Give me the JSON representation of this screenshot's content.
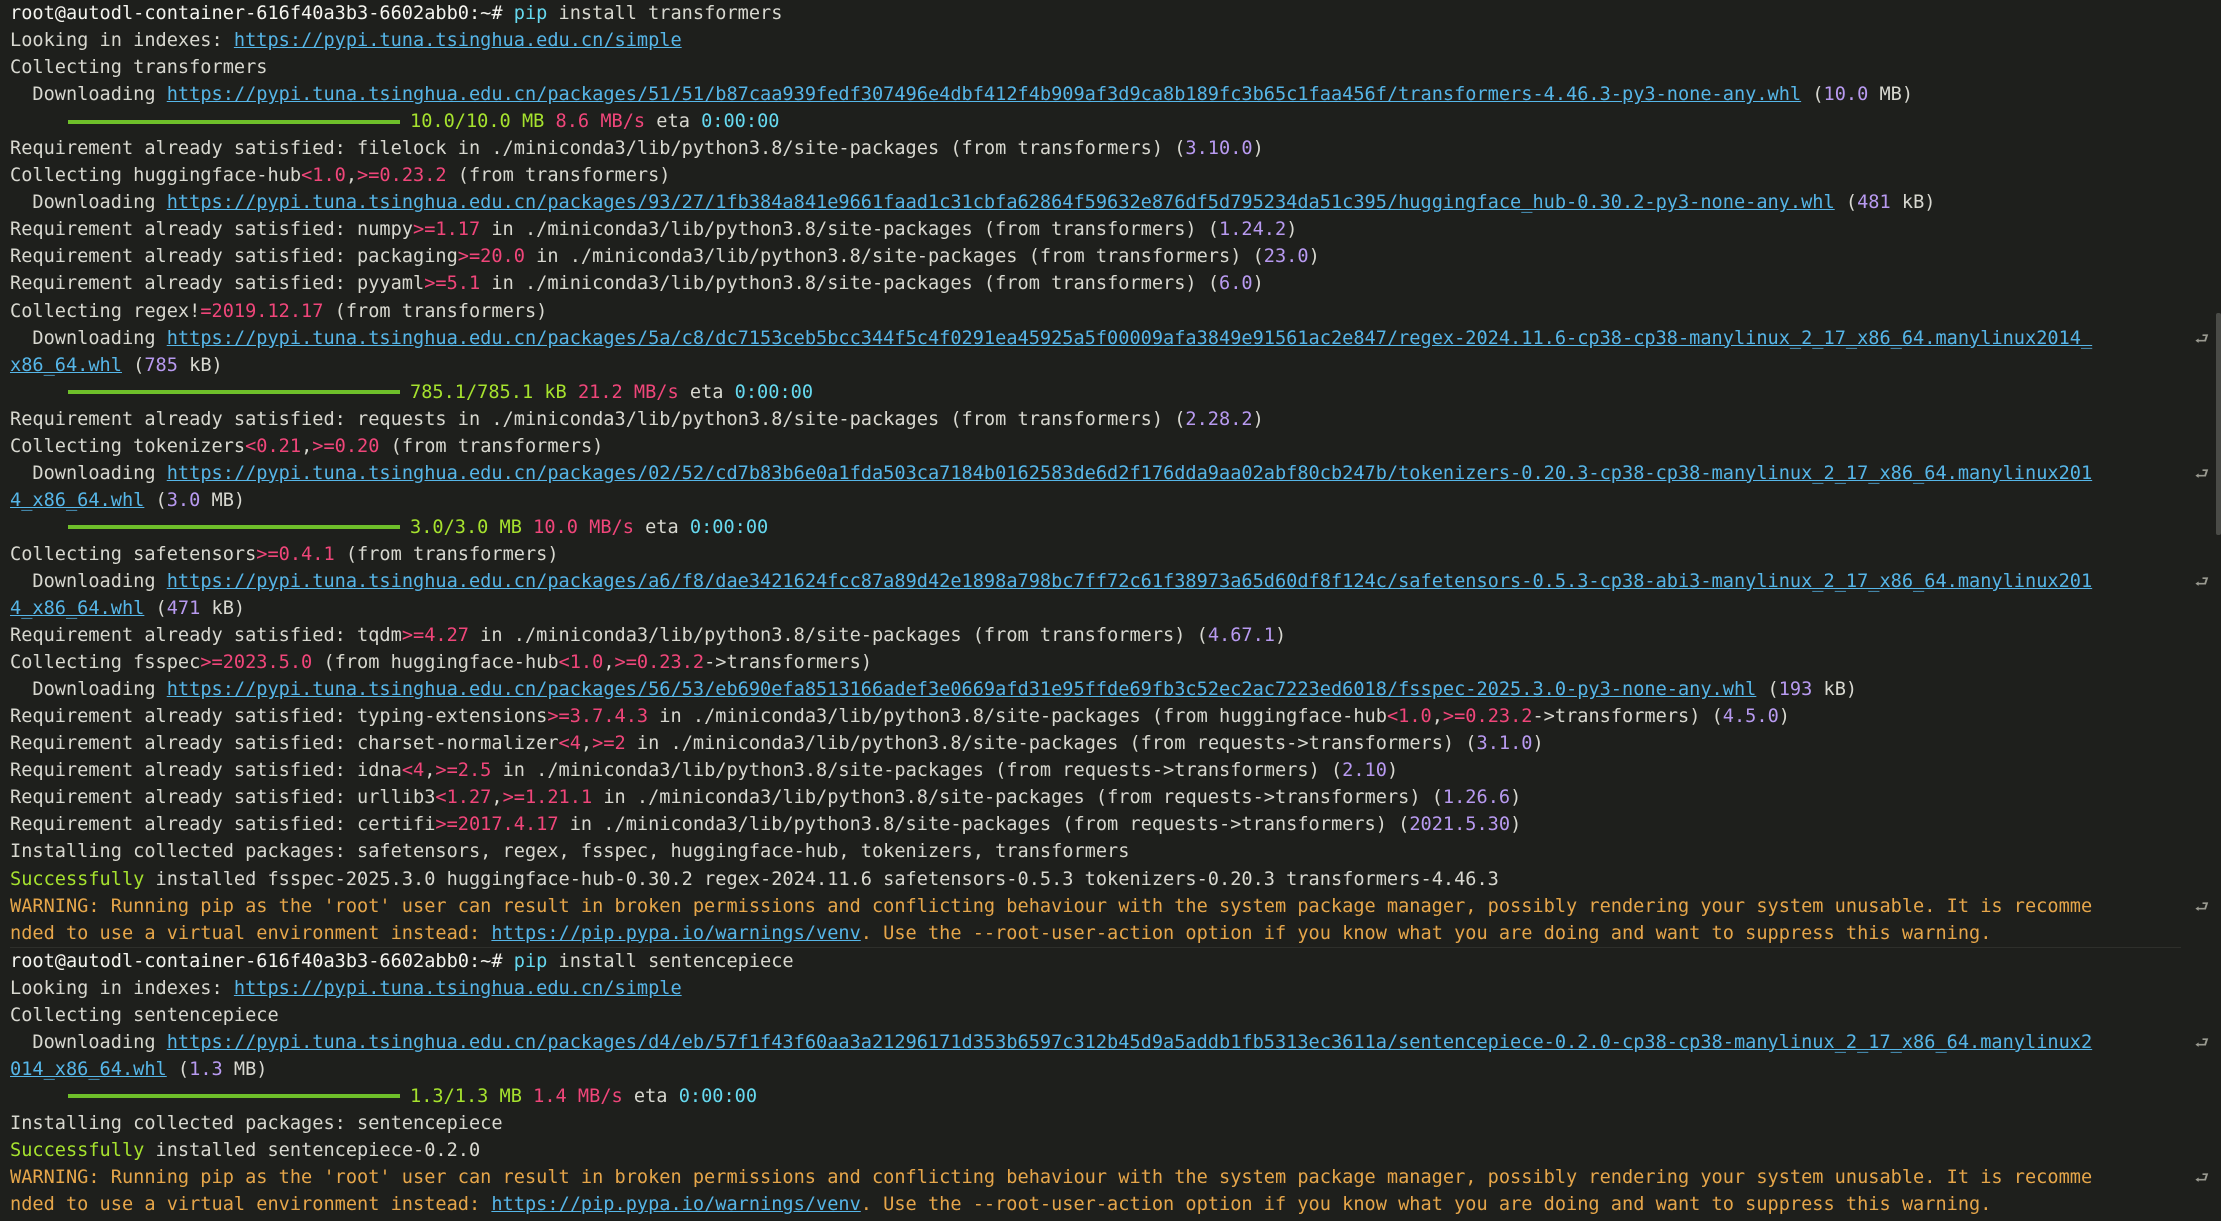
{
  "prompt": "root@autodl-container-616f40a3b3-6602abb0:~#",
  "lines": [
    {
      "segs": [
        [
          "t-bright",
          "root@autodl-container-616f40a3b3-6602abb0:~# "
        ],
        [
          "t-cyan",
          "pip"
        ],
        [
          "t-cmd",
          " install transformers"
        ]
      ]
    },
    {
      "segs": [
        [
          "t-plain",
          "Looking in indexes: "
        ],
        [
          "t-url",
          "https://pypi.tuna.tsinghua.edu.cn/simple"
        ]
      ]
    },
    {
      "segs": [
        [
          "t-plain",
          "Collecting transformers"
        ]
      ]
    },
    {
      "segs": [
        [
          "t-plain",
          "  Downloading "
        ],
        [
          "t-url",
          "https://pypi.tuna.tsinghua.edu.cn/packages/51/51/b87caa939fedf307496e4dbf412f4b909af3d9ca8b189fc3b65c1faa456f/transformers-4.46.3-py3-none-any.whl"
        ],
        [
          "t-plain",
          " ("
        ],
        [
          "t-num",
          "10.0"
        ],
        [
          "t-plain",
          " MB)"
        ]
      ]
    },
    {
      "progress": 1.0,
      "segs": [
        [
          "t-green",
          "10.0/10.0 MB"
        ],
        [
          "t-plain",
          " "
        ],
        [
          "t-pink",
          "8.6 MB/s"
        ],
        [
          "t-plain",
          " eta "
        ],
        [
          "t-cyan",
          "0:00:00"
        ]
      ]
    },
    {
      "segs": [
        [
          "t-plain",
          "Requirement already satisfied: filelock in ./miniconda3/lib/python3.8/site-packages (from transformers) ("
        ],
        [
          "t-num",
          "3.10.0"
        ],
        [
          "t-plain",
          ")"
        ]
      ]
    },
    {
      "segs": [
        [
          "t-plain",
          "Collecting huggingface-hub"
        ],
        [
          "t-pink",
          "<1.0"
        ],
        [
          "t-plain",
          ","
        ],
        [
          "t-pink",
          ">=0.23.2"
        ],
        [
          "t-plain",
          " (from transformers)"
        ]
      ]
    },
    {
      "segs": [
        [
          "t-plain",
          "  Downloading "
        ],
        [
          "t-url",
          "https://pypi.tuna.tsinghua.edu.cn/packages/93/27/1fb384a841e9661faad1c31cbfa62864f59632e876df5d795234da51c395/huggingface_hub-0.30.2-py3-none-any.whl"
        ],
        [
          "t-plain",
          " ("
        ],
        [
          "t-num",
          "481"
        ],
        [
          "t-plain",
          " kB)"
        ]
      ]
    },
    {
      "segs": [
        [
          "t-plain",
          "Requirement already satisfied: numpy"
        ],
        [
          "t-pink",
          ">=1.17"
        ],
        [
          "t-plain",
          " in ./miniconda3/lib/python3.8/site-packages (from transformers) ("
        ],
        [
          "t-num",
          "1.24.2"
        ],
        [
          "t-plain",
          ")"
        ]
      ]
    },
    {
      "segs": [
        [
          "t-plain",
          "Requirement already satisfied: packaging"
        ],
        [
          "t-pink",
          ">=20.0"
        ],
        [
          "t-plain",
          " in ./miniconda3/lib/python3.8/site-packages (from transformers) ("
        ],
        [
          "t-num",
          "23.0"
        ],
        [
          "t-plain",
          ")"
        ]
      ]
    },
    {
      "segs": [
        [
          "t-plain",
          "Requirement already satisfied: pyyaml"
        ],
        [
          "t-pink",
          ">=5.1"
        ],
        [
          "t-plain",
          " in ./miniconda3/lib/python3.8/site-packages (from transformers) ("
        ],
        [
          "t-num",
          "6.0"
        ],
        [
          "t-plain",
          ")"
        ]
      ]
    },
    {
      "segs": [
        [
          "t-plain",
          "Collecting regex!"
        ],
        [
          "t-pink",
          "=2019.12.17"
        ],
        [
          "t-plain",
          " (from transformers)"
        ]
      ]
    },
    {
      "wrap": true,
      "segs": [
        [
          "t-plain",
          "  Downloading "
        ],
        [
          "t-url",
          "https://pypi.tuna.tsinghua.edu.cn/packages/5a/c8/dc7153ceb5bcc344f5c4f0291ea45925a5f00009afa3849e91561ac2e847/regex-2024.11.6-cp38-cp38-manylinux_2_17_x86_64.manylinux2014_"
        ]
      ]
    },
    {
      "segs": [
        [
          "t-url",
          "x86_64.whl"
        ],
        [
          "t-plain",
          " ("
        ],
        [
          "t-num",
          "785"
        ],
        [
          "t-plain",
          " kB)"
        ]
      ]
    },
    {
      "progress": 1.0,
      "segs": [
        [
          "t-green",
          "785.1/785.1 kB"
        ],
        [
          "t-plain",
          " "
        ],
        [
          "t-pink",
          "21.2 MB/s"
        ],
        [
          "t-plain",
          " eta "
        ],
        [
          "t-cyan",
          "0:00:00"
        ]
      ]
    },
    {
      "segs": [
        [
          "t-plain",
          "Requirement already satisfied: requests in ./miniconda3/lib/python3.8/site-packages (from transformers) ("
        ],
        [
          "t-num",
          "2.28.2"
        ],
        [
          "t-plain",
          ")"
        ]
      ]
    },
    {
      "segs": [
        [
          "t-plain",
          "Collecting tokenizers"
        ],
        [
          "t-pink",
          "<0.21"
        ],
        [
          "t-plain",
          ","
        ],
        [
          "t-pink",
          ">=0.20"
        ],
        [
          "t-plain",
          " (from transformers)"
        ]
      ]
    },
    {
      "wrap": true,
      "segs": [
        [
          "t-plain",
          "  Downloading "
        ],
        [
          "t-url",
          "https://pypi.tuna.tsinghua.edu.cn/packages/02/52/cd7b83b6e0a1fda503ca7184b0162583de6d2f176dda9aa02abf80cb247b/tokenizers-0.20.3-cp38-cp38-manylinux_2_17_x86_64.manylinux201"
        ]
      ]
    },
    {
      "segs": [
        [
          "t-url",
          "4_x86_64.whl"
        ],
        [
          "t-plain",
          " ("
        ],
        [
          "t-num",
          "3.0"
        ],
        [
          "t-plain",
          " MB)"
        ]
      ]
    },
    {
      "progress": 1.0,
      "segs": [
        [
          "t-green",
          "3.0/3.0 MB"
        ],
        [
          "t-plain",
          " "
        ],
        [
          "t-pink",
          "10.0 MB/s"
        ],
        [
          "t-plain",
          " eta "
        ],
        [
          "t-cyan",
          "0:00:00"
        ]
      ]
    },
    {
      "segs": [
        [
          "t-plain",
          "Collecting safetensors"
        ],
        [
          "t-pink",
          ">=0.4.1"
        ],
        [
          "t-plain",
          " (from transformers)"
        ]
      ]
    },
    {
      "wrap": true,
      "segs": [
        [
          "t-plain",
          "  Downloading "
        ],
        [
          "t-url",
          "https://pypi.tuna.tsinghua.edu.cn/packages/a6/f8/dae3421624fcc87a89d42e1898a798bc7ff72c61f38973a65d60df8f124c/safetensors-0.5.3-cp38-abi3-manylinux_2_17_x86_64.manylinux201"
        ]
      ]
    },
    {
      "segs": [
        [
          "t-url",
          "4_x86_64.whl"
        ],
        [
          "t-plain",
          " ("
        ],
        [
          "t-num",
          "471"
        ],
        [
          "t-plain",
          " kB)"
        ]
      ]
    },
    {
      "segs": [
        [
          "t-plain",
          "Requirement already satisfied: tqdm"
        ],
        [
          "t-pink",
          ">=4.27"
        ],
        [
          "t-plain",
          " in ./miniconda3/lib/python3.8/site-packages (from transformers) ("
        ],
        [
          "t-num",
          "4.67.1"
        ],
        [
          "t-plain",
          ")"
        ]
      ]
    },
    {
      "segs": [
        [
          "t-plain",
          "Collecting fsspec"
        ],
        [
          "t-pink",
          ">=2023.5.0"
        ],
        [
          "t-plain",
          " (from huggingface-hub"
        ],
        [
          "t-pink",
          "<1.0"
        ],
        [
          "t-plain",
          ","
        ],
        [
          "t-pink",
          ">=0.23.2"
        ],
        [
          "t-plain",
          "->transformers)"
        ]
      ]
    },
    {
      "segs": [
        [
          "t-plain",
          "  Downloading "
        ],
        [
          "t-url",
          "https://pypi.tuna.tsinghua.edu.cn/packages/56/53/eb690efa8513166adef3e0669afd31e95ffde69fb3c52ec2ac7223ed6018/fsspec-2025.3.0-py3-none-any.whl"
        ],
        [
          "t-plain",
          " ("
        ],
        [
          "t-num",
          "193"
        ],
        [
          "t-plain",
          " kB)"
        ]
      ]
    },
    {
      "segs": [
        [
          "t-plain",
          "Requirement already satisfied: typing-extensions"
        ],
        [
          "t-pink",
          ">=3.7.4.3"
        ],
        [
          "t-plain",
          " in ./miniconda3/lib/python3.8/site-packages (from huggingface-hub"
        ],
        [
          "t-pink",
          "<1.0"
        ],
        [
          "t-plain",
          ","
        ],
        [
          "t-pink",
          ">=0.23.2"
        ],
        [
          "t-plain",
          "->transformers) ("
        ],
        [
          "t-num",
          "4.5.0"
        ],
        [
          "t-plain",
          ")"
        ]
      ]
    },
    {
      "segs": [
        [
          "t-plain",
          "Requirement already satisfied: charset-normalizer"
        ],
        [
          "t-pink",
          "<4"
        ],
        [
          "t-plain",
          ","
        ],
        [
          "t-pink",
          ">=2"
        ],
        [
          "t-plain",
          " in ./miniconda3/lib/python3.8/site-packages (from requests->transformers) ("
        ],
        [
          "t-num",
          "3.1.0"
        ],
        [
          "t-plain",
          ")"
        ]
      ]
    },
    {
      "segs": [
        [
          "t-plain",
          "Requirement already satisfied: idna"
        ],
        [
          "t-pink",
          "<4"
        ],
        [
          "t-plain",
          ","
        ],
        [
          "t-pink",
          ">=2.5"
        ],
        [
          "t-plain",
          " in ./miniconda3/lib/python3.8/site-packages (from requests->transformers) ("
        ],
        [
          "t-num",
          "2.10"
        ],
        [
          "t-plain",
          ")"
        ]
      ]
    },
    {
      "segs": [
        [
          "t-plain",
          "Requirement already satisfied: urllib3"
        ],
        [
          "t-pink",
          "<1.27"
        ],
        [
          "t-plain",
          ","
        ],
        [
          "t-pink",
          ">=1.21.1"
        ],
        [
          "t-plain",
          " in ./miniconda3/lib/python3.8/site-packages (from requests->transformers) ("
        ],
        [
          "t-num",
          "1.26.6"
        ],
        [
          "t-plain",
          ")"
        ]
      ]
    },
    {
      "segs": [
        [
          "t-plain",
          "Requirement already satisfied: certifi"
        ],
        [
          "t-pink",
          ">=2017.4.17"
        ],
        [
          "t-plain",
          " in ./miniconda3/lib/python3.8/site-packages (from requests->transformers) ("
        ],
        [
          "t-num",
          "2021.5.30"
        ],
        [
          "t-plain",
          ")"
        ]
      ]
    },
    {
      "segs": [
        [
          "t-plain",
          "Installing collected packages: safetensors, regex, fsspec, huggingface-hub, tokenizers, transformers"
        ]
      ]
    },
    {
      "segs": [
        [
          "t-green",
          "Successfully"
        ],
        [
          "t-plain",
          " installed fsspec-2025.3.0 huggingface-hub-0.30.2 regex-2024.11.6 safetensors-0.5.3 tokenizers-0.20.3 transformers-4.46.3"
        ]
      ]
    },
    {
      "wrap": true,
      "segs": [
        [
          "t-warn",
          "WARNING: Running pip as the 'root' user can result in broken permissions and conflicting behaviour with the system package manager, possibly rendering your system unusable. It is recomme"
        ]
      ]
    },
    {
      "segs": [
        [
          "t-warn",
          "nded to use a virtual environment instead: "
        ],
        [
          "t-url",
          "https://pip.pypa.io/warnings/venv"
        ],
        [
          "t-warn",
          ". Use the --root-user-action option if you know what you are doing and want to suppress this warning."
        ]
      ]
    },
    {
      "sep": true,
      "segs": [
        [
          "t-bright",
          "root@autodl-container-616f40a3b3-6602abb0:~# "
        ],
        [
          "t-cyan",
          "pip"
        ],
        [
          "t-cmd",
          " install sentencepiece"
        ]
      ]
    },
    {
      "segs": [
        [
          "t-plain",
          "Looking in indexes: "
        ],
        [
          "t-url",
          "https://pypi.tuna.tsinghua.edu.cn/simple"
        ]
      ]
    },
    {
      "segs": [
        [
          "t-plain",
          "Collecting sentencepiece"
        ]
      ]
    },
    {
      "wrap": true,
      "segs": [
        [
          "t-plain",
          "  Downloading "
        ],
        [
          "t-url",
          "https://pypi.tuna.tsinghua.edu.cn/packages/d4/eb/57f1f43f60aa3a21296171d353b6597c312b45d9a5addb1fb5313ec3611a/sentencepiece-0.2.0-cp38-cp38-manylinux_2_17_x86_64.manylinux2"
        ]
      ]
    },
    {
      "segs": [
        [
          "t-url",
          "014_x86_64.whl"
        ],
        [
          "t-plain",
          " ("
        ],
        [
          "t-num",
          "1.3"
        ],
        [
          "t-plain",
          " MB)"
        ]
      ]
    },
    {
      "progress": 1.0,
      "segs": [
        [
          "t-green",
          "1.3/1.3 MB"
        ],
        [
          "t-plain",
          " "
        ],
        [
          "t-pink",
          "1.4 MB/s"
        ],
        [
          "t-plain",
          " eta "
        ],
        [
          "t-cyan",
          "0:00:00"
        ]
      ]
    },
    {
      "segs": [
        [
          "t-plain",
          "Installing collected packages: sentencepiece"
        ]
      ]
    },
    {
      "segs": [
        [
          "t-green",
          "Successfully"
        ],
        [
          "t-plain",
          " installed sentencepiece-0.2.0"
        ]
      ]
    },
    {
      "wrap": true,
      "segs": [
        [
          "t-warn",
          "WARNING: Running pip as the 'root' user can result in broken permissions and conflicting behaviour with the system package manager, possibly rendering your system unusable. It is recomme"
        ]
      ]
    },
    {
      "segs": [
        [
          "t-warn",
          "nded to use a virtual environment instead: "
        ],
        [
          "t-url",
          "https://pip.pypa.io/warnings/venv"
        ],
        [
          "t-warn",
          ". Use the --root-user-action option if you know what you are doing and want to suppress this warning."
        ]
      ]
    }
  ],
  "wrap_glyph": "⮐",
  "colors": {
    "background": "#1e1f1c",
    "url": "#56b6e8",
    "progress": "#6fbf2a",
    "speed": "#f0467a",
    "version": "#b89af0",
    "warning": "#e6a64a"
  }
}
